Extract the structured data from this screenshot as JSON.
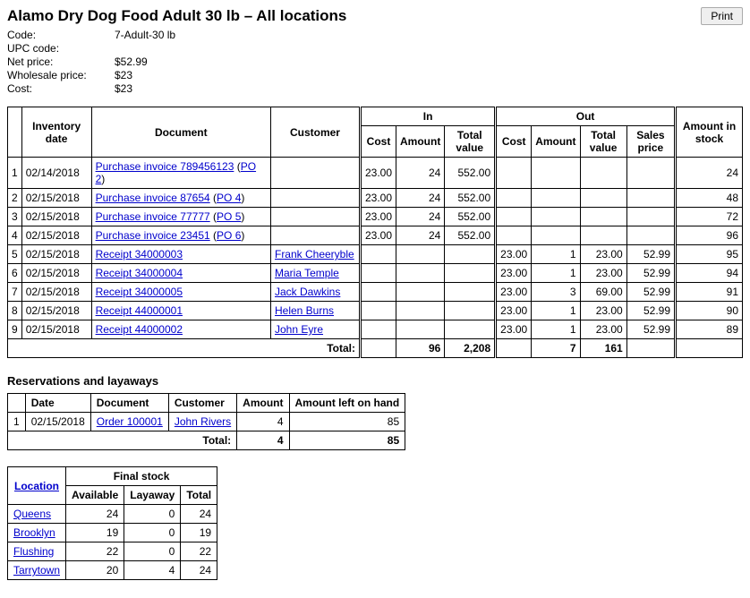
{
  "header": {
    "title": "Alamo Dry Dog Food Adult 30 lb – All locations",
    "print_label": "Print"
  },
  "meta": {
    "code_label": "Code:",
    "code": "7-Adult-30 lb",
    "upc_label": "UPC code:",
    "upc": "",
    "netprice_label": "Net price:",
    "netprice": "$52.99",
    "wholesale_label": "Wholesale price:",
    "wholesale": "$23",
    "cost_label": "Cost:",
    "cost": "$23"
  },
  "main_table": {
    "col_inventory_date": "Inventory date",
    "col_document": "Document",
    "col_customer": "Customer",
    "col_in": "In",
    "col_out": "Out",
    "col_cost": "Cost",
    "col_amount": "Amount",
    "col_total_value": "Total value",
    "col_sales_price": "Sales price",
    "col_amount_in_stock": "Amount in stock",
    "rows": [
      {
        "n": "1",
        "date": "02/14/2018",
        "doc": "Purchase invoice 789456123",
        "po": "PO 2",
        "customer": "",
        "in_cost": "23.00",
        "in_amount": "24",
        "in_total": "552.00",
        "out_cost": "",
        "out_amount": "",
        "out_total": "",
        "sales": "",
        "stock": "24"
      },
      {
        "n": "2",
        "date": "02/15/2018",
        "doc": "Purchase invoice 87654",
        "po": "PO 4",
        "customer": "",
        "in_cost": "23.00",
        "in_amount": "24",
        "in_total": "552.00",
        "out_cost": "",
        "out_amount": "",
        "out_total": "",
        "sales": "",
        "stock": "48"
      },
      {
        "n": "3",
        "date": "02/15/2018",
        "doc": "Purchase invoice 77777",
        "po": "PO 5",
        "customer": "",
        "in_cost": "23.00",
        "in_amount": "24",
        "in_total": "552.00",
        "out_cost": "",
        "out_amount": "",
        "out_total": "",
        "sales": "",
        "stock": "72"
      },
      {
        "n": "4",
        "date": "02/15/2018",
        "doc": "Purchase invoice 23451",
        "po": "PO 6",
        "customer": "",
        "in_cost": "23.00",
        "in_amount": "24",
        "in_total": "552.00",
        "out_cost": "",
        "out_amount": "",
        "out_total": "",
        "sales": "",
        "stock": "96"
      },
      {
        "n": "5",
        "date": "02/15/2018",
        "doc": "Receipt 34000003",
        "po": "",
        "customer": "Frank Cheeryble",
        "in_cost": "",
        "in_amount": "",
        "in_total": "",
        "out_cost": "23.00",
        "out_amount": "1",
        "out_total": "23.00",
        "sales": "52.99",
        "stock": "95"
      },
      {
        "n": "6",
        "date": "02/15/2018",
        "doc": "Receipt 34000004",
        "po": "",
        "customer": "Maria Temple",
        "in_cost": "",
        "in_amount": "",
        "in_total": "",
        "out_cost": "23.00",
        "out_amount": "1",
        "out_total": "23.00",
        "sales": "52.99",
        "stock": "94"
      },
      {
        "n": "7",
        "date": "02/15/2018",
        "doc": "Receipt 34000005",
        "po": "",
        "customer": "Jack Dawkins",
        "in_cost": "",
        "in_amount": "",
        "in_total": "",
        "out_cost": "23.00",
        "out_amount": "3",
        "out_total": "69.00",
        "sales": "52.99",
        "stock": "91"
      },
      {
        "n": "8",
        "date": "02/15/2018",
        "doc": "Receipt 44000001",
        "po": "",
        "customer": "Helen Burns",
        "in_cost": "",
        "in_amount": "",
        "in_total": "",
        "out_cost": "23.00",
        "out_amount": "1",
        "out_total": "23.00",
        "sales": "52.99",
        "stock": "90"
      },
      {
        "n": "9",
        "date": "02/15/2018",
        "doc": "Receipt 44000002",
        "po": "",
        "customer": "John Eyre",
        "in_cost": "",
        "in_amount": "",
        "in_total": "",
        "out_cost": "23.00",
        "out_amount": "1",
        "out_total": "23.00",
        "sales": "52.99",
        "stock": "89"
      }
    ],
    "total_label": "Total:",
    "total_in_amount": "96",
    "total_in_value": "2,208",
    "total_out_amount": "7",
    "total_out_value": "161"
  },
  "reservations": {
    "title": "Reservations and layaways",
    "col_date": "Date",
    "col_document": "Document",
    "col_customer": "Customer",
    "col_amount": "Amount",
    "col_leftonhand": "Amount left on hand",
    "rows": [
      {
        "n": "1",
        "date": "02/15/2018",
        "doc": "Order 100001",
        "customer": "John Rivers",
        "amount": "4",
        "left": "85"
      }
    ],
    "total_label": "Total:",
    "total_amount": "4",
    "total_left": "85"
  },
  "final": {
    "col_location": "Location",
    "col_finalstock": "Final stock",
    "col_available": "Available",
    "col_layaway": "Layaway",
    "col_total": "Total",
    "rows": [
      {
        "loc": "Queens",
        "avail": "24",
        "lay": "0",
        "total": "24"
      },
      {
        "loc": "Brooklyn",
        "avail": "19",
        "lay": "0",
        "total": "19"
      },
      {
        "loc": "Flushing",
        "avail": "22",
        "lay": "0",
        "total": "22"
      },
      {
        "loc": "Tarrytown",
        "avail": "20",
        "lay": "4",
        "total": "24"
      }
    ]
  }
}
